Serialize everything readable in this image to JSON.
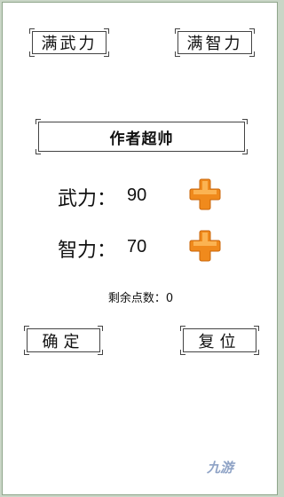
{
  "buttons": {
    "max_force": "满武力",
    "max_intellect": "满智力",
    "author": "作者超帅",
    "confirm": "确定",
    "reset": "复位"
  },
  "stats": {
    "force_label": "武力：",
    "force_value": "90",
    "intellect_label": "智力：",
    "intellect_value": "70"
  },
  "remaining": {
    "label": "剩余点数：",
    "value": "0"
  },
  "icons": {
    "plus_color": "#f08a1c",
    "plus_highlight": "#ffd27a"
  },
  "watermark": "九游"
}
